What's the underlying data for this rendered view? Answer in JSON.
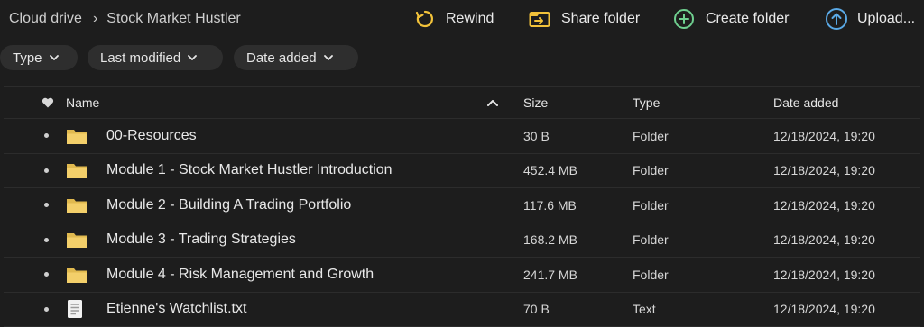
{
  "breadcrumb": {
    "root": "Cloud drive",
    "current": "Stock Market Hustler"
  },
  "toolbar": {
    "rewind": "Rewind",
    "share": "Share folder",
    "create": "Create folder",
    "upload": "Upload..."
  },
  "filters": {
    "type": "Type",
    "modified": "Last modified",
    "added": "Date added"
  },
  "columns": {
    "name": "Name",
    "size": "Size",
    "type": "Type",
    "date": "Date added"
  },
  "rows": [
    {
      "name": "00-Resources",
      "size": "30 B",
      "type": "Folder",
      "date": "12/18/2024, 19:20",
      "icon": "folder-icon"
    },
    {
      "name": "Module 1 - Stock Market Hustler Introduction",
      "size": "452.4 MB",
      "type": "Folder",
      "date": "12/18/2024, 19:20",
      "icon": "folder-icon"
    },
    {
      "name": "Module 2 - Building A Trading Portfolio",
      "size": "117.6 MB",
      "type": "Folder",
      "date": "12/18/2024, 19:20",
      "icon": "folder-icon"
    },
    {
      "name": "Module 3 - Trading Strategies",
      "size": "168.2 MB",
      "type": "Folder",
      "date": "12/18/2024, 19:20",
      "icon": "folder-icon"
    },
    {
      "name": "Module 4 - Risk Management and Growth",
      "size": "241.7 MB",
      "type": "Folder",
      "date": "12/18/2024, 19:20",
      "icon": "folder-icon"
    },
    {
      "name": "Etienne's Watchlist.txt",
      "size": "70 B",
      "type": "Text",
      "date": "12/18/2024, 19:20",
      "icon": "text-file-icon"
    }
  ],
  "colors": {
    "background": "#1d1d1d",
    "accent_yellow": "#f2c23a",
    "accent_green": "#6fcf8f",
    "accent_blue": "#5aa9e6",
    "folder": "#f3cf6a"
  }
}
